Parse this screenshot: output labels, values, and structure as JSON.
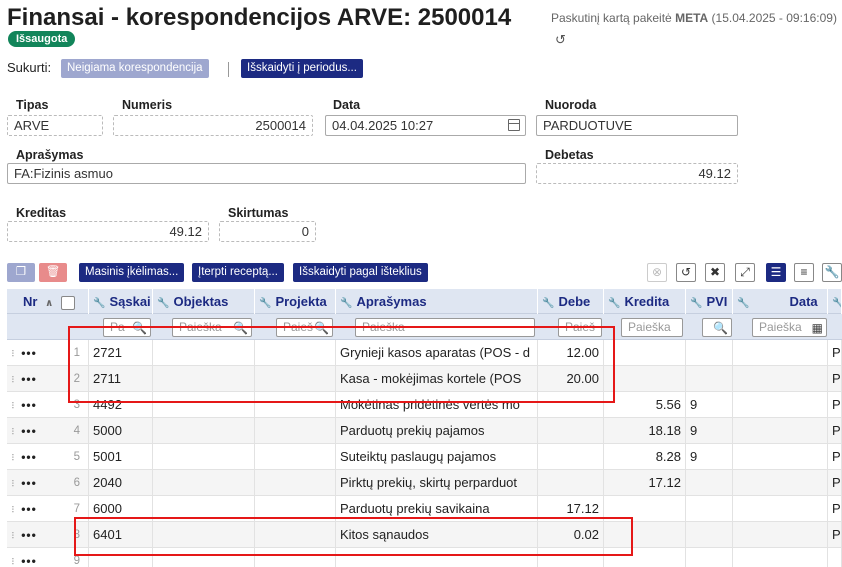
{
  "header": {
    "title": "Finansai - korespondencijos ARVE: 2500014",
    "status_badge": "Išsaugota",
    "modified_prefix": "Paskutinį kartą pakeitė",
    "modified_user": "META",
    "modified_time": "(15.04.2025 - 09:16:09)",
    "history_icon": "history-icon"
  },
  "created": {
    "label": "Sukurti:",
    "negative_btn": "Neigiama korespondencija",
    "split_btn": "Išskaidyti į periodus..."
  },
  "form": {
    "tipas": {
      "label": "Tipas",
      "value": "ARVE"
    },
    "numeris": {
      "label": "Numeris",
      "value": "2500014"
    },
    "data": {
      "label": "Data",
      "value": "04.04.2025 10:27"
    },
    "nuoroda": {
      "label": "Nuoroda",
      "value": "PARDUOTUVE"
    },
    "aprasymas": {
      "label": "Aprašymas",
      "value": "FA:Fizinis asmuo"
    },
    "debetas": {
      "label": "Debetas",
      "value": "49.12"
    },
    "kreditas": {
      "label": "Kreditas",
      "value": "49.12"
    },
    "skirtumas": {
      "label": "Skirtumas",
      "value": "0"
    }
  },
  "toolbar": {
    "mass_import": "Masinis įkėlimas...",
    "insert_recipe": "Įterpti receptą...",
    "split_by_resource": "Išskaidyti pagal išteklius",
    "colors": {
      "navy": "#1c2a82",
      "danger": "#e88b8b",
      "copy": "#9ea7cf",
      "badge": "#12855a",
      "highlight": "#e51818"
    }
  },
  "grid": {
    "columns": {
      "nr": "Nr",
      "saskaita": "Sąskai",
      "objektas": "Objektas",
      "projektas": "Projekta",
      "aprasymas": "Aprašymas",
      "debe": "Debe",
      "kredita": "Kredita",
      "pvm": "PVI",
      "data": "Data"
    },
    "filters": {
      "saskaita": "Pa",
      "objektas": "Paieška",
      "projektas": "Paieš",
      "aprasymas": "Paieška",
      "debe": "Paieš",
      "kredita": "Paieška",
      "pvm": "",
      "data": "Paieška"
    },
    "rows": [
      {
        "nr": "1",
        "saskaita": "2721",
        "aprasymas": "Grynieji kasos aparatas (POS - d",
        "debe": "12.00",
        "kredita": "",
        "pvm": "",
        "tail": "P"
      },
      {
        "nr": "2",
        "saskaita": "2711",
        "aprasymas": "Kasa - mokėjimas kortele (POS",
        "debe": "20.00",
        "kredita": "",
        "pvm": "",
        "tail": "P"
      },
      {
        "nr": "3",
        "saskaita": "4492",
        "aprasymas": "Mokėtinas pridėtinės vertės mo",
        "debe": "",
        "kredita": "5.56",
        "pvm": "9",
        "tail": "P"
      },
      {
        "nr": "4",
        "saskaita": "5000",
        "aprasymas": "Parduotų prekių pajamos",
        "debe": "",
        "kredita": "18.18",
        "pvm": "9",
        "tail": "P"
      },
      {
        "nr": "5",
        "saskaita": "5001",
        "aprasymas": "Suteiktų paslaugų pajamos",
        "debe": "",
        "kredita": "8.28",
        "pvm": "9",
        "tail": "P"
      },
      {
        "nr": "6",
        "saskaita": "2040",
        "aprasymas": "Pirktų prekių, skirtų perparduot",
        "debe": "",
        "kredita": "17.12",
        "pvm": "",
        "tail": "P"
      },
      {
        "nr": "7",
        "saskaita": "6000",
        "aprasymas": "Parduotų prekių savikaina",
        "debe": "17.12",
        "kredita": "",
        "pvm": "",
        "tail": "P"
      },
      {
        "nr": "8",
        "saskaita": "6401",
        "aprasymas": "Kitos sąnaudos",
        "debe": "0.02",
        "kredita": "",
        "pvm": "",
        "tail": "P"
      },
      {
        "nr": "9",
        "saskaita": "",
        "aprasymas": "",
        "debe": "",
        "kredita": "",
        "pvm": "",
        "tail": ""
      }
    ]
  }
}
